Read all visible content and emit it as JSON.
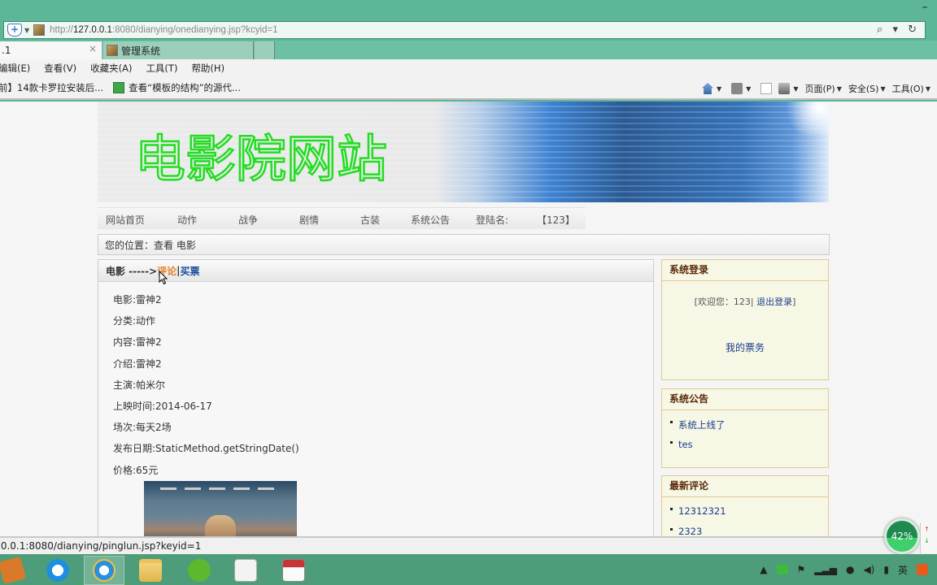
{
  "browser": {
    "window_controls": {
      "minimize": "–"
    },
    "address": {
      "scheme": "http://",
      "host": "127.0.0.1",
      "rest": ":8080/dianying/onedianying.jsp?kcyid=1",
      "tools": "⌕ ▾ ↻"
    },
    "tabs": [
      {
        "label": ".1",
        "active": true,
        "close": "×"
      },
      {
        "label": "管理系统",
        "active": false
      }
    ],
    "menu": [
      "编辑(E)",
      "查看(V)",
      "收藏夹(A)",
      "工具(T)",
      "帮助(H)"
    ],
    "favorites": [
      {
        "label": "前】14款卡罗拉安装后..."
      },
      {
        "label": "查看“模板的结构”的源代..."
      }
    ],
    "command_bar": {
      "page": "页面(P)",
      "safety": "安全(S)",
      "tools": "工具(O)"
    },
    "status_url": ".0.0.1:8080/dianying/pinglun.jsp?keyid=1"
  },
  "site": {
    "title": "电影院网站",
    "nav": [
      {
        "label": "网站首页"
      },
      {
        "label": "动作"
      },
      {
        "label": "战争"
      },
      {
        "label": "剧情"
      },
      {
        "label": "古装"
      },
      {
        "label": "系统公告"
      },
      {
        "label": "登陆名:"
      },
      {
        "label": "【123】"
      }
    ],
    "breadcrumb": "您的位置：查看 电影",
    "movie_panel": {
      "header_prefix": "电影 ----->",
      "review_link": "评论",
      "separator": "|",
      "buy_link": "买票",
      "details": [
        "电影:雷神2",
        "分类:动作",
        "内容:雷神2",
        "介绍:雷神2",
        "主演:帕米尔",
        "上映时间:2014-06-17",
        "场次:每天2场",
        "发布日期:StaticMethod.getStringDate()",
        "价格:65元"
      ]
    },
    "login_box": {
      "title": "系统登录",
      "welcome_prefix": "[欢迎您：123|",
      "logout": "退出登录",
      "welcome_suffix": "]",
      "my_tickets": "我的票务"
    },
    "notice_box": {
      "title": "系统公告",
      "items": [
        "系统上线了",
        "tes"
      ]
    },
    "comments_box": {
      "title": "最新评论",
      "items": [
        "12312321",
        "2323"
      ]
    }
  },
  "taskbar": {
    "tray_lang": "英",
    "gauge_value": "42%",
    "accent": "#4e9d7a"
  }
}
